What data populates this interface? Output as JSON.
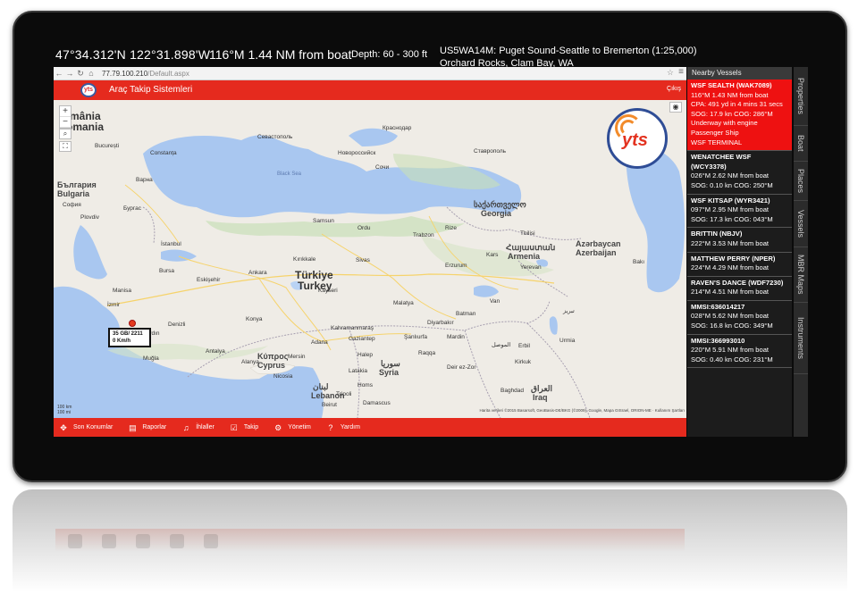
{
  "status": {
    "coordinates": "47°34.312'N  122°31.898'W",
    "bearing": "116°M 1.44 NM from boat",
    "depth": "Depth: 60 - 300 ft",
    "chart_line1": "US5WA14M: Puget Sound-Seattle to Bremerton (1:25,000)",
    "chart_line2": "Orchard Rocks, Clam Bay, WA"
  },
  "browser": {
    "url_host": "77.79.100.210",
    "url_path": "/Default.aspx"
  },
  "app": {
    "title": "Araç Takip Sistemleri",
    "logo_small": "yts",
    "logo_text": "yts",
    "exit_label": "Çıkış"
  },
  "map": {
    "zoom_in": "+",
    "zoom_out": "−",
    "labels": {
      "romania": "mânia",
      "romania2": "omania",
      "bulgaria1": "България",
      "bulgaria2": "Bulgaria",
      "turkey1": "Türkiye",
      "turkey2": "Turkey",
      "georgia1": "საქართველო",
      "georgia2": "Georgia",
      "armenia1": "Հայաստան",
      "armenia2": "Armenia",
      "azer1": "Azərbaycan",
      "azer2": "Azerbaijan",
      "syria1": "سوريا",
      "syria2": "Syria",
      "lebanon1": "لبنان",
      "lebanon2": "Lebanon",
      "cyprus1": "Κύπρος",
      "cyprus2": "Cyprus",
      "iraq1": "العراق",
      "iraq2": "Iraq",
      "bucuresti": "București",
      "constanta": "Constanța",
      "varna": "Варна",
      "istanbul": "İstanbul",
      "ankara": "Ankara",
      "izmir": "İzmir",
      "antalya": "Antalya",
      "konya": "Konya",
      "adana": "Adana",
      "samsun": "Samsun",
      "trabzon": "Trabzon",
      "erzurum": "Erzurum",
      "kayseri": "Kayseri",
      "sivas": "Sivas",
      "malatya": "Malatya",
      "diyarbakir": "Diyarbakır",
      "van": "Van",
      "gaziantep": "Gaziantep",
      "aleppo": "Halep",
      "mosul": "الموصل",
      "baghdad": "Baghdad",
      "tbilisi": "Tbilisi",
      "baku": "Bakı",
      "yerevan": "Yerevan",
      "sevastopol": "Севастополь",
      "krasnodar": "Краснодар",
      "stavropol": "Ставрополь",
      "sochi": "Сочи",
      "novorossiysk": "Новороссийск",
      "blacksea": "Black Sea",
      "bursa": "Bursa",
      "eskisehir": "Eskişehir",
      "kirikkale": "Kırıkkale",
      "burgas": "Бургас",
      "plovdiv": "Plovdiv",
      "sofia": "София",
      "tripoli": "Tripoli",
      "damascus": "Damascus",
      "beirut": "Beirut",
      "kahramanmaras": "Kahramanmaraş",
      "sanliurfa": "Şanlıurfa",
      "batman": "Batman",
      "mardin": "Mardin",
      "kirkuk": "Kirkuk",
      "erbil": "Erbil",
      "tabriz": "تبریز",
      "urmia": "Urmia",
      "rize": "Rize",
      "kars": "Kars",
      "ordu": "Ordu",
      "mersin": "Mersin",
      "alanya": "Alanya",
      "manisa": "Manisa",
      "denizli": "Denizli",
      "mugla": "Muğla",
      "aydin": "Aydın",
      "homs": "Homs",
      "latakia": "Latakia",
      "deir": "Deir ez-Zor",
      "raqqa": "Raqqa",
      "nicosia": "Nicosia"
    },
    "info_line1": "35 GB/ 2211",
    "info_line2": "0 Km/h",
    "scale_top": "100 km",
    "scale_bottom": "100 mi",
    "attribution": "Harita verileri ©2015 Basarsoft, GeoBasis-DE/BKG (©2009), Google, Mapa GISrael, ORION-ME · Kullanım Şartları"
  },
  "footer": [
    {
      "icon": "crosshair-icon",
      "glyph": "✥",
      "label": "Son Konumlar"
    },
    {
      "icon": "document-icon",
      "glyph": "▤",
      "label": "Raporlar"
    },
    {
      "icon": "bell-icon",
      "glyph": "♫",
      "label": "İhlaller"
    },
    {
      "icon": "checkbox-icon",
      "glyph": "☑",
      "label": "Takip"
    },
    {
      "icon": "gear-icon",
      "glyph": "⚙",
      "label": "Yönetim"
    },
    {
      "icon": "help-icon",
      "glyph": "?",
      "label": "Yardım"
    }
  ],
  "panel": {
    "title": "Nearby Vessels",
    "vessels": [
      {
        "name": "WSF SEALTH (WAK7089)",
        "lines": [
          "116°M 1.43 NM from boat",
          "CPA: 491 yd in 4 mins 31 secs",
          "SOG: 17.9 kn   COG: 286°M",
          "Underway with engine",
          "Passenger Ship",
          "WSF TERMINAL"
        ]
      },
      {
        "name": "WENATCHEE WSF (WCY3378)",
        "lines": [
          "026°M 2.62 NM from boat",
          "SOG: 0.10 kn   COG: 250°M"
        ]
      },
      {
        "name": "WSF KITSAP (WYR3421)",
        "lines": [
          "097°M 2.95 NM from boat",
          "SOG: 17.3 kn   COG: 043°M"
        ]
      },
      {
        "name": "BRITTIN (NBJV)",
        "lines": [
          "222°M 3.53 NM from boat"
        ]
      },
      {
        "name": "MATTHEW PERRY (NPER)",
        "lines": [
          "224°M 4.29 NM from boat"
        ]
      },
      {
        "name": "RAVEN'S DANCE (WDF7230)",
        "lines": [
          "214°M 4.51 NM from boat"
        ]
      },
      {
        "name": "MMSI:636014217",
        "lines": [
          "028°M 5.62 NM from boat",
          "SOG: 16.8 kn   COG: 349°M"
        ]
      },
      {
        "name": "MMSI:366993010",
        "lines": [
          "220°M 5.91 NM from boat",
          "SOG: 0.40 kn   COG: 231°M"
        ]
      }
    ]
  },
  "sidetabs": [
    "Properties",
    "Boat",
    "Places",
    "Vessels",
    "MBR Maps",
    "Instruments"
  ],
  "colors": {
    "accent_red": "#e52a1e",
    "active_vessel": "#ee1111",
    "sea": "#a9c7f0",
    "land": "#efece6"
  }
}
